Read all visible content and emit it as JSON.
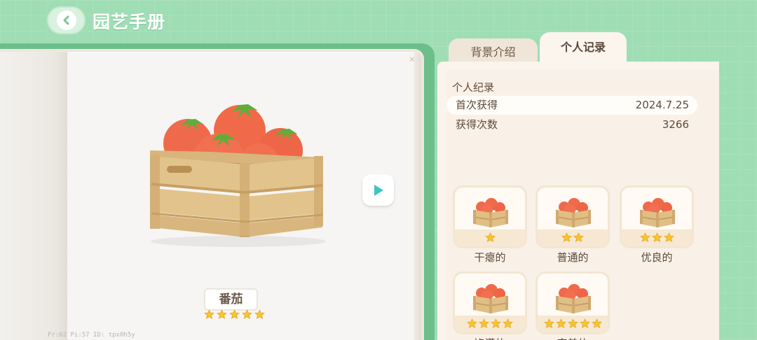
{
  "header": {
    "title": "园艺手册"
  },
  "item": {
    "name": "番茄",
    "stars": 5,
    "debug_text": "Fr:62   Pi:57   ID: tpx0h5y"
  },
  "tabs": [
    {
      "label": "背景介绍",
      "active": false
    },
    {
      "label": "个人记录",
      "active": true
    }
  ],
  "record": {
    "section_title": "个人纪录",
    "rows": [
      {
        "key": "首次获得",
        "value": "2024.7.25"
      },
      {
        "key": "获得次数",
        "value": "3266"
      }
    ]
  },
  "qualities": [
    {
      "label": "干瘪的",
      "stars": 1
    },
    {
      "label": "普通的",
      "stars": 2
    },
    {
      "label": "优良的",
      "stars": 3
    },
    {
      "label": "饱满的",
      "stars": 4
    },
    {
      "label": "完美的",
      "stars": 5
    }
  ],
  "colors": {
    "background": "#9fddb4",
    "panel": "#fbf4ec",
    "star": "#f7c531",
    "tomato": "#f06a4a",
    "crate": "#e0bf86"
  },
  "icons": {
    "back": "chevron-left-icon",
    "next": "play-arrow-icon",
    "star": "star-icon"
  }
}
